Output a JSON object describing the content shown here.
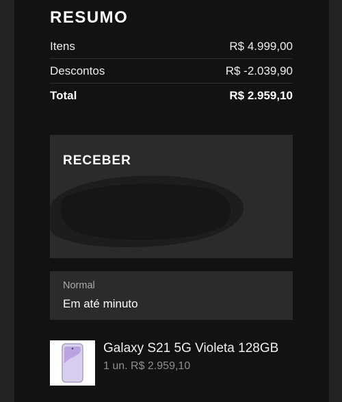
{
  "summary": {
    "title": "RESUMO",
    "items_label": "Itens",
    "items_value": "R$ 4.999,00",
    "discounts_label": "Descontos",
    "discounts_value": "R$ -2.039,90",
    "total_label": "Total",
    "total_value": "R$ 2.959,10"
  },
  "receive": {
    "title": "RECEBER",
    "address_redacted": true
  },
  "delivery": {
    "type": "Normal",
    "time": "Em até minuto"
  },
  "product": {
    "name": "Galaxy S21 5G Violeta 128GB",
    "quantity_price": "1 un. R$ 2.959,10",
    "thumbnail_icon": "phone-icon",
    "phone_color": "#cdbfe6"
  },
  "colors": {
    "background": "#121212",
    "card": "#2b2b2b",
    "text_primary": "#ffffff",
    "text_secondary": "#a9a9a9"
  }
}
